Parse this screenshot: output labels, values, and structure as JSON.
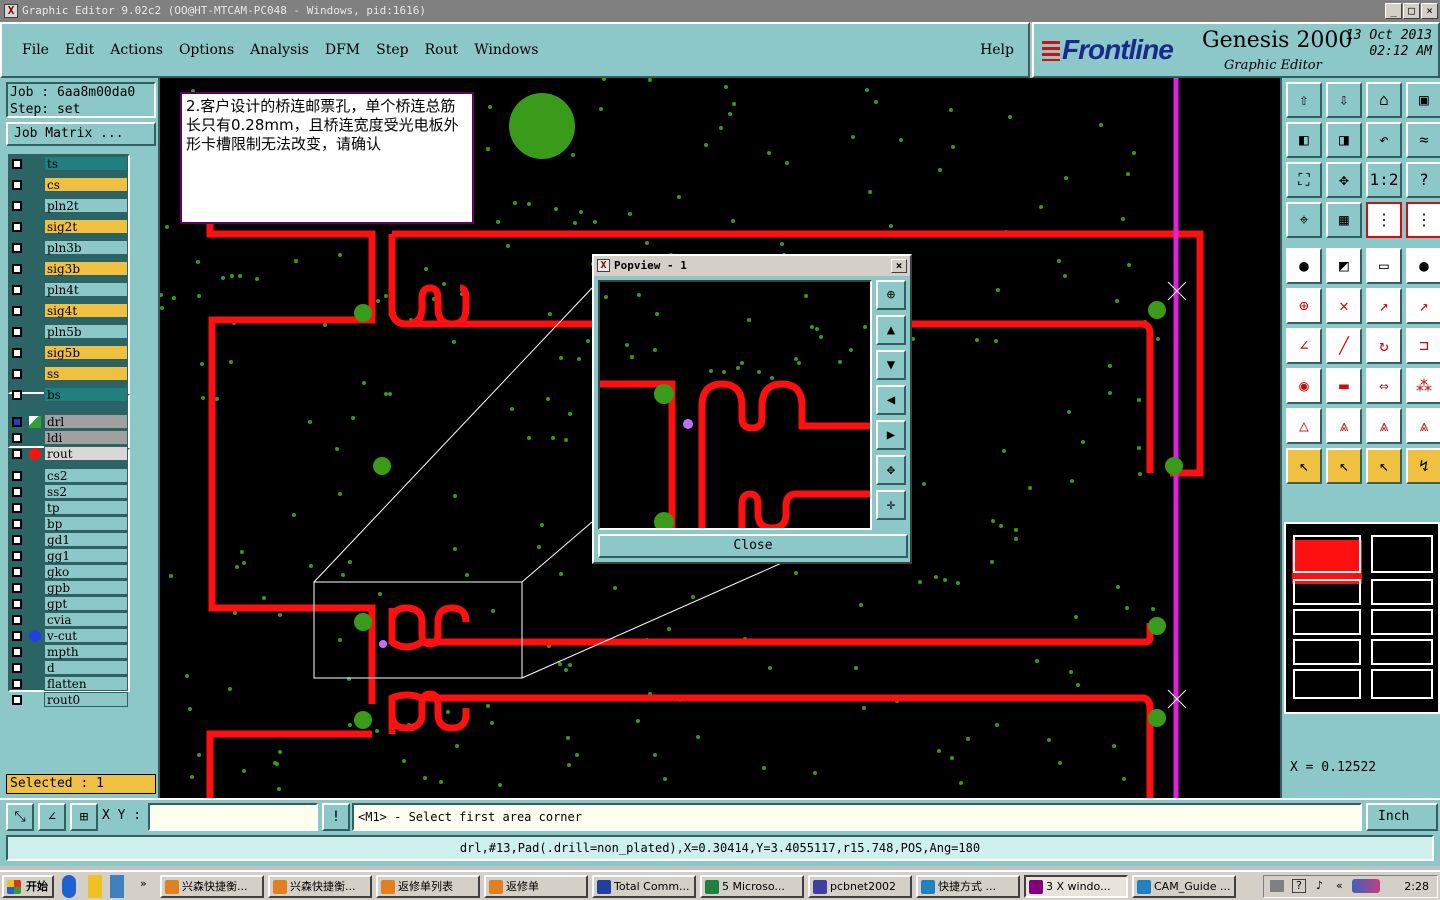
{
  "window": {
    "title": "Graphic Editor 9.02c2  (OO@HT-MTCAM-PC048 - Windows, pid:1616)",
    "min": "_",
    "max": "□",
    "close": "×"
  },
  "menu": {
    "items": [
      "File",
      "Edit",
      "Actions",
      "Options",
      "Analysis",
      "DFM",
      "Step",
      "Rout",
      "Windows"
    ],
    "help": "Help"
  },
  "brand": {
    "logo": "Frontline",
    "product": "Genesis 2000",
    "subtitle": "Graphic Editor",
    "date": "13 Oct 2013",
    "time": "02:12 AM"
  },
  "job": {
    "job_line": "Job : 6aa8m00da0",
    "step_line": "Step: set",
    "matrix_button": "Job Matrix ..."
  },
  "layers": [
    {
      "name": "ts",
      "color": "#208080"
    },
    {
      "name": "cs",
      "color": "#f0c040"
    },
    {
      "name": "pln2t",
      "color": "#8cc8c8"
    },
    {
      "name": "sig2t",
      "color": "#f0c040"
    },
    {
      "name": "pln3b",
      "color": "#8cc8c8"
    },
    {
      "name": "sig3b",
      "color": "#f0c040"
    },
    {
      "name": "pln4t",
      "color": "#8cc8c8"
    },
    {
      "name": "sig4t",
      "color": "#f0c040"
    },
    {
      "name": "pln5b",
      "color": "#8cc8c8"
    },
    {
      "name": "sig5b",
      "color": "#f0c040"
    },
    {
      "name": "ss",
      "color": "#f0c040"
    },
    {
      "name": "bs",
      "color": "#208080"
    },
    {
      "name": "drl",
      "color": "#a0a0a0"
    },
    {
      "name": "ldi",
      "color": "#a0a0a0"
    },
    {
      "name": "rout",
      "color": "#d8d8d8"
    },
    {
      "name": "cs2",
      "color": "#8cc8c8"
    },
    {
      "name": "ss2",
      "color": "#8cc8c8"
    },
    {
      "name": "tp",
      "color": "#8cc8c8"
    },
    {
      "name": "bp",
      "color": "#8cc8c8"
    },
    {
      "name": "gd1",
      "color": "#8cc8c8"
    },
    {
      "name": "gg1",
      "color": "#8cc8c8"
    },
    {
      "name": "gko",
      "color": "#8cc8c8"
    },
    {
      "name": "gpb",
      "color": "#8cc8c8"
    },
    {
      "name": "gpt",
      "color": "#8cc8c8"
    },
    {
      "name": "cvia",
      "color": "#8cc8c8"
    },
    {
      "name": "v-cut",
      "color": "#8cc8c8"
    },
    {
      "name": "mpth",
      "color": "#8cc8c8"
    },
    {
      "name": "d",
      "color": "#8cc8c8"
    },
    {
      "name": "flatten",
      "color": "#8cc8c8"
    },
    {
      "name": "rout0",
      "color": "#8cc8c8"
    }
  ],
  "selected": "Selected : 1",
  "note": "2.客户设计的桥连邮票孔，单个桥连总筋长只有0.28mm，且桥连宽度受光电板外形卡槽限制无法改变，请确认",
  "popview": {
    "title": "Popview - 1",
    "close_label": "Close",
    "close_x": "×"
  },
  "coords": {
    "x_readout": "X = 0.12522"
  },
  "cmd": {
    "xy_label": "X Y :",
    "xy_value": "",
    "bang": "!",
    "prompt": "<M1> - Select first area corner",
    "units": "Inch"
  },
  "status": "drl,#13,Pad(.drill=non_plated),X=0.30414,Y=3.4055117,r15.748,POS,Ang=180",
  "taskbar": {
    "start": "开始",
    "tasks": [
      {
        "label": "兴森快捷衡...",
        "color": "#e08020"
      },
      {
        "label": "兴森快捷衡...",
        "color": "#e08020"
      },
      {
        "label": "返修单列表",
        "color": "#e08020"
      },
      {
        "label": "返修单",
        "color": "#e08020"
      },
      {
        "label": "Total Comm...",
        "color": "#2040a0"
      },
      {
        "label": "5 Microso...",
        "color": "#208040"
      },
      {
        "label": "pcbnet2002",
        "color": "#4040a0"
      },
      {
        "label": "快捷方式 ...",
        "color": "#2080c0"
      },
      {
        "label": "3 X windo...",
        "color": "#800080"
      },
      {
        "label": "CAM_Guide ...",
        "color": "#2080c0"
      }
    ],
    "quicklaunch": "»",
    "clock": "2:28"
  }
}
